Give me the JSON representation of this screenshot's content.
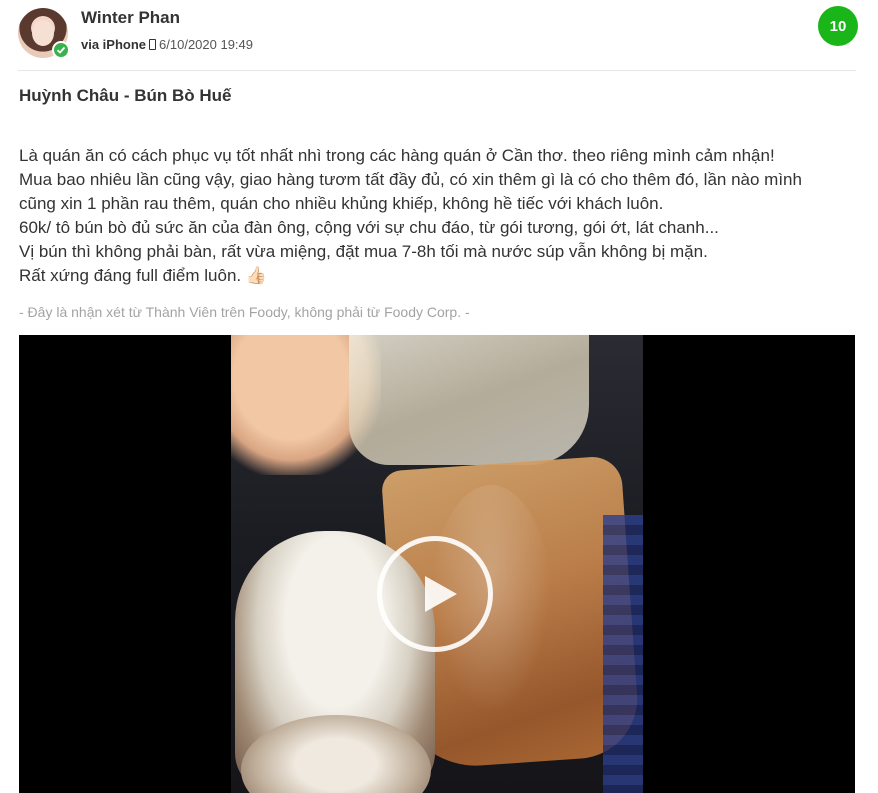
{
  "header": {
    "username": "Winter Phan",
    "via": "via iPhone",
    "date": "6/10/2020 19:49",
    "score": "10"
  },
  "review": {
    "title": "Huỳnh Châu - Bún Bò Huế",
    "lines": [
      "Là quán ăn có cách phục vụ tốt nhất nhì trong các hàng quán ở Cần thơ. theo riêng mình cảm nhận!",
      "Mua bao nhiêu lần cũng vậy, giao hàng tươm tất đầy đủ, có xin thêm gì là có cho thêm đó, lần nào mình",
      "cũng xin 1 phần rau thêm, quán cho nhiều khủng khiếp, không hề tiếc với khách luôn.",
      "60k/ tô bún bò đủ sức ăn của đàn ông, cộng với sự chu đáo, từ gói tương, gói ớt, lát chanh...",
      "Vị bún thì không phải bàn, rất vừa miệng, đặt mua 7-8h tối mà nước súp vẫn không bị mặn.",
      "Rất xứng đáng full điểm luôn. 👍🏻"
    ],
    "disclaimer": "- Đây là nhận xét từ Thành Viên trên Foody, không phải từ Foody Corp. -"
  },
  "colors": {
    "score_bg": "#19b519",
    "verified": "#37b24d"
  }
}
